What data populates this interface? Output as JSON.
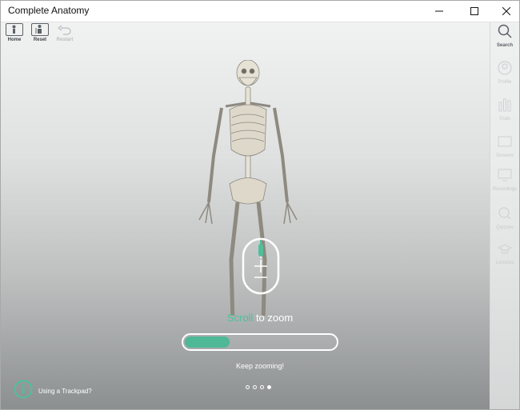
{
  "window": {
    "title": "Complete Anatomy",
    "controls": [
      "minimize",
      "maximize",
      "close"
    ]
  },
  "toolbar": {
    "items": [
      {
        "label": "Home",
        "icon": "home-icon",
        "enabled": true
      },
      {
        "label": "Reset",
        "icon": "reset-icon",
        "enabled": true
      },
      {
        "label": "Restart",
        "icon": "undo-icon",
        "enabled": false
      }
    ]
  },
  "sidebar": {
    "items": [
      {
        "label": "Search",
        "icon": "search-icon",
        "active": true
      },
      {
        "label": "Profile",
        "icon": "profile-icon",
        "active": false
      },
      {
        "label": "Trials",
        "icon": "trials-icon",
        "active": false
      },
      {
        "label": "Screens",
        "icon": "screens-icon",
        "active": false
      },
      {
        "label": "Recordings",
        "icon": "recordings-icon",
        "active": false
      },
      {
        "label": "Quizzes",
        "icon": "quizzes-icon",
        "active": false
      },
      {
        "label": "Lectures",
        "icon": "lectures-icon",
        "active": false
      }
    ]
  },
  "tutorial": {
    "action_word": "Scroll",
    "action_rest": " to zoom",
    "progress": 0.3,
    "feedback": "Keep zooming!",
    "steps_total": 4,
    "step_current": 4,
    "trackpad_label": "Using a Trackpad?"
  },
  "colors": {
    "accent": "#4ec09b",
    "progress_fill": "#4fb896",
    "background_top": "#f1f2f2",
    "background_bottom": "#8c8f90"
  }
}
